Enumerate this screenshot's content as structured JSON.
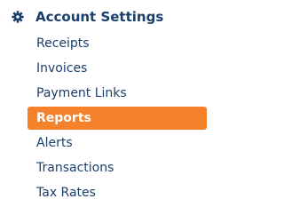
{
  "menu": {
    "header": {
      "label": "Account Settings",
      "icon": "gear-icon"
    },
    "items": [
      {
        "label": "Receipts",
        "active": false
      },
      {
        "label": "Invoices",
        "active": false
      },
      {
        "label": "Payment Links",
        "active": false
      },
      {
        "label": "Reports",
        "active": true
      },
      {
        "label": "Alerts",
        "active": false
      },
      {
        "label": "Transactions",
        "active": false
      },
      {
        "label": "Tax Rates",
        "active": false
      }
    ]
  },
  "colors": {
    "text": "#1b3f6b",
    "active_bg": "#f5822b",
    "active_text": "#ffffff"
  }
}
